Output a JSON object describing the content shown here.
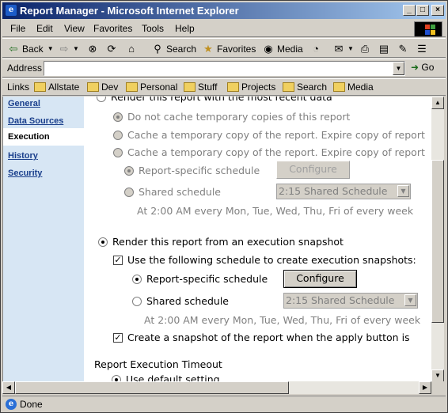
{
  "window": {
    "title": "Report Manager - Microsoft Internet Explorer"
  },
  "menu": [
    "File",
    "Edit",
    "View",
    "Favorites",
    "Tools",
    "Help"
  ],
  "toolbar": {
    "back": "Back",
    "search": "Search",
    "favorites": "Favorites",
    "media": "Media"
  },
  "address": {
    "label": "Address",
    "value": "",
    "go": "Go"
  },
  "links": {
    "label": "Links",
    "items": [
      "Allstate",
      "Dev",
      "Personal",
      "Stuff",
      "Projects",
      "Search",
      "Media"
    ]
  },
  "nav": {
    "items": [
      "General",
      "Data Sources",
      "Execution",
      "History",
      "Security"
    ],
    "active": "Execution"
  },
  "execution": {
    "render_recent": "Render this report with the most recent data",
    "no_cache": "Do not cache temporary copies of this report",
    "cache_expire_1": "Cache a temporary copy of the report. Expire copy of report",
    "cache_expire_2": "Cache a temporary copy of the report. Expire copy of report",
    "report_specific_1": "Report-specific schedule",
    "configure_1": "Configure",
    "shared_1": "Shared schedule",
    "shared_select_1": "2:15 Shared Schedule",
    "schedule_desc_1": "At 2:00 AM every Mon, Tue, Wed, Thu, Fri of every week",
    "render_snapshot": "Render this report from an execution snapshot",
    "use_schedule": "Use the following schedule to create execution snapshots:",
    "report_specific_2": "Report-specific schedule",
    "configure_2": "Configure",
    "shared_2": "Shared schedule",
    "shared_select_2": "2:15 Shared Schedule",
    "schedule_desc_2": "At 2:00 AM every Mon, Tue, Wed, Thu, Fri of every week",
    "create_snapshot": "Create a snapshot of the report when the apply button is",
    "timeout_heading": "Report Execution Timeout",
    "use_default": "Use default setting"
  },
  "status": {
    "text": "Done"
  }
}
